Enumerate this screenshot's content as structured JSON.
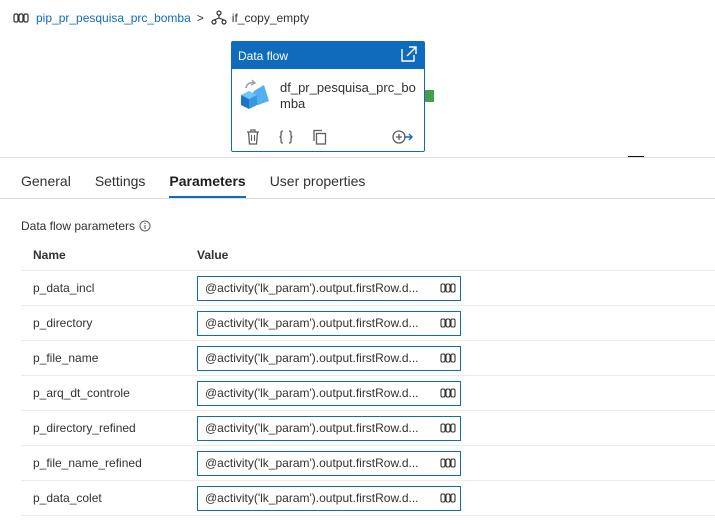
{
  "breadcrumb": {
    "pipeline_icon": "pipeline-icon",
    "pipeline": "pip_pr_pesquisa_prc_bomba",
    "separator": ">",
    "activity_icon": "if-condition-icon",
    "activity": "if_copy_empty"
  },
  "card": {
    "type": "Data flow",
    "name": "df_pr_pesquisa_prc_bomba",
    "icons": [
      "open-external-icon",
      "dataflow-icon",
      "delete-icon",
      "code-icon",
      "copy-icon",
      "add-output-icon"
    ]
  },
  "tabs": [
    {
      "label": "General",
      "active": false
    },
    {
      "label": "Settings",
      "active": false
    },
    {
      "label": "Parameters",
      "active": true
    },
    {
      "label": "User properties",
      "active": false
    }
  ],
  "section": {
    "title": "Data flow parameters",
    "info_icon": "info-icon"
  },
  "table": {
    "headers": {
      "name": "Name",
      "value": "Value"
    },
    "rows": [
      {
        "name": "p_data_incl",
        "value": "@activity('lk_param').output.firstRow.d..."
      },
      {
        "name": "p_directory",
        "value": "@activity('lk_param').output.firstRow.d..."
      },
      {
        "name": "p_file_name",
        "value": "@activity('lk_param').output.firstRow.d..."
      },
      {
        "name": "p_arq_dt_controle",
        "value": "@activity('lk_param').output.firstRow.d..."
      },
      {
        "name": "p_directory_refined",
        "value": "@activity('lk_param').output.firstRow.d..."
      },
      {
        "name": "p_file_name_refined",
        "value": "@activity('lk_param').output.firstRow.d..."
      },
      {
        "name": "p_data_colet",
        "value": "@activity('lk_param').output.firstRow.d..."
      }
    ]
  },
  "colors": {
    "accent": "#0f6cbd",
    "port": "#4c9a4c"
  }
}
